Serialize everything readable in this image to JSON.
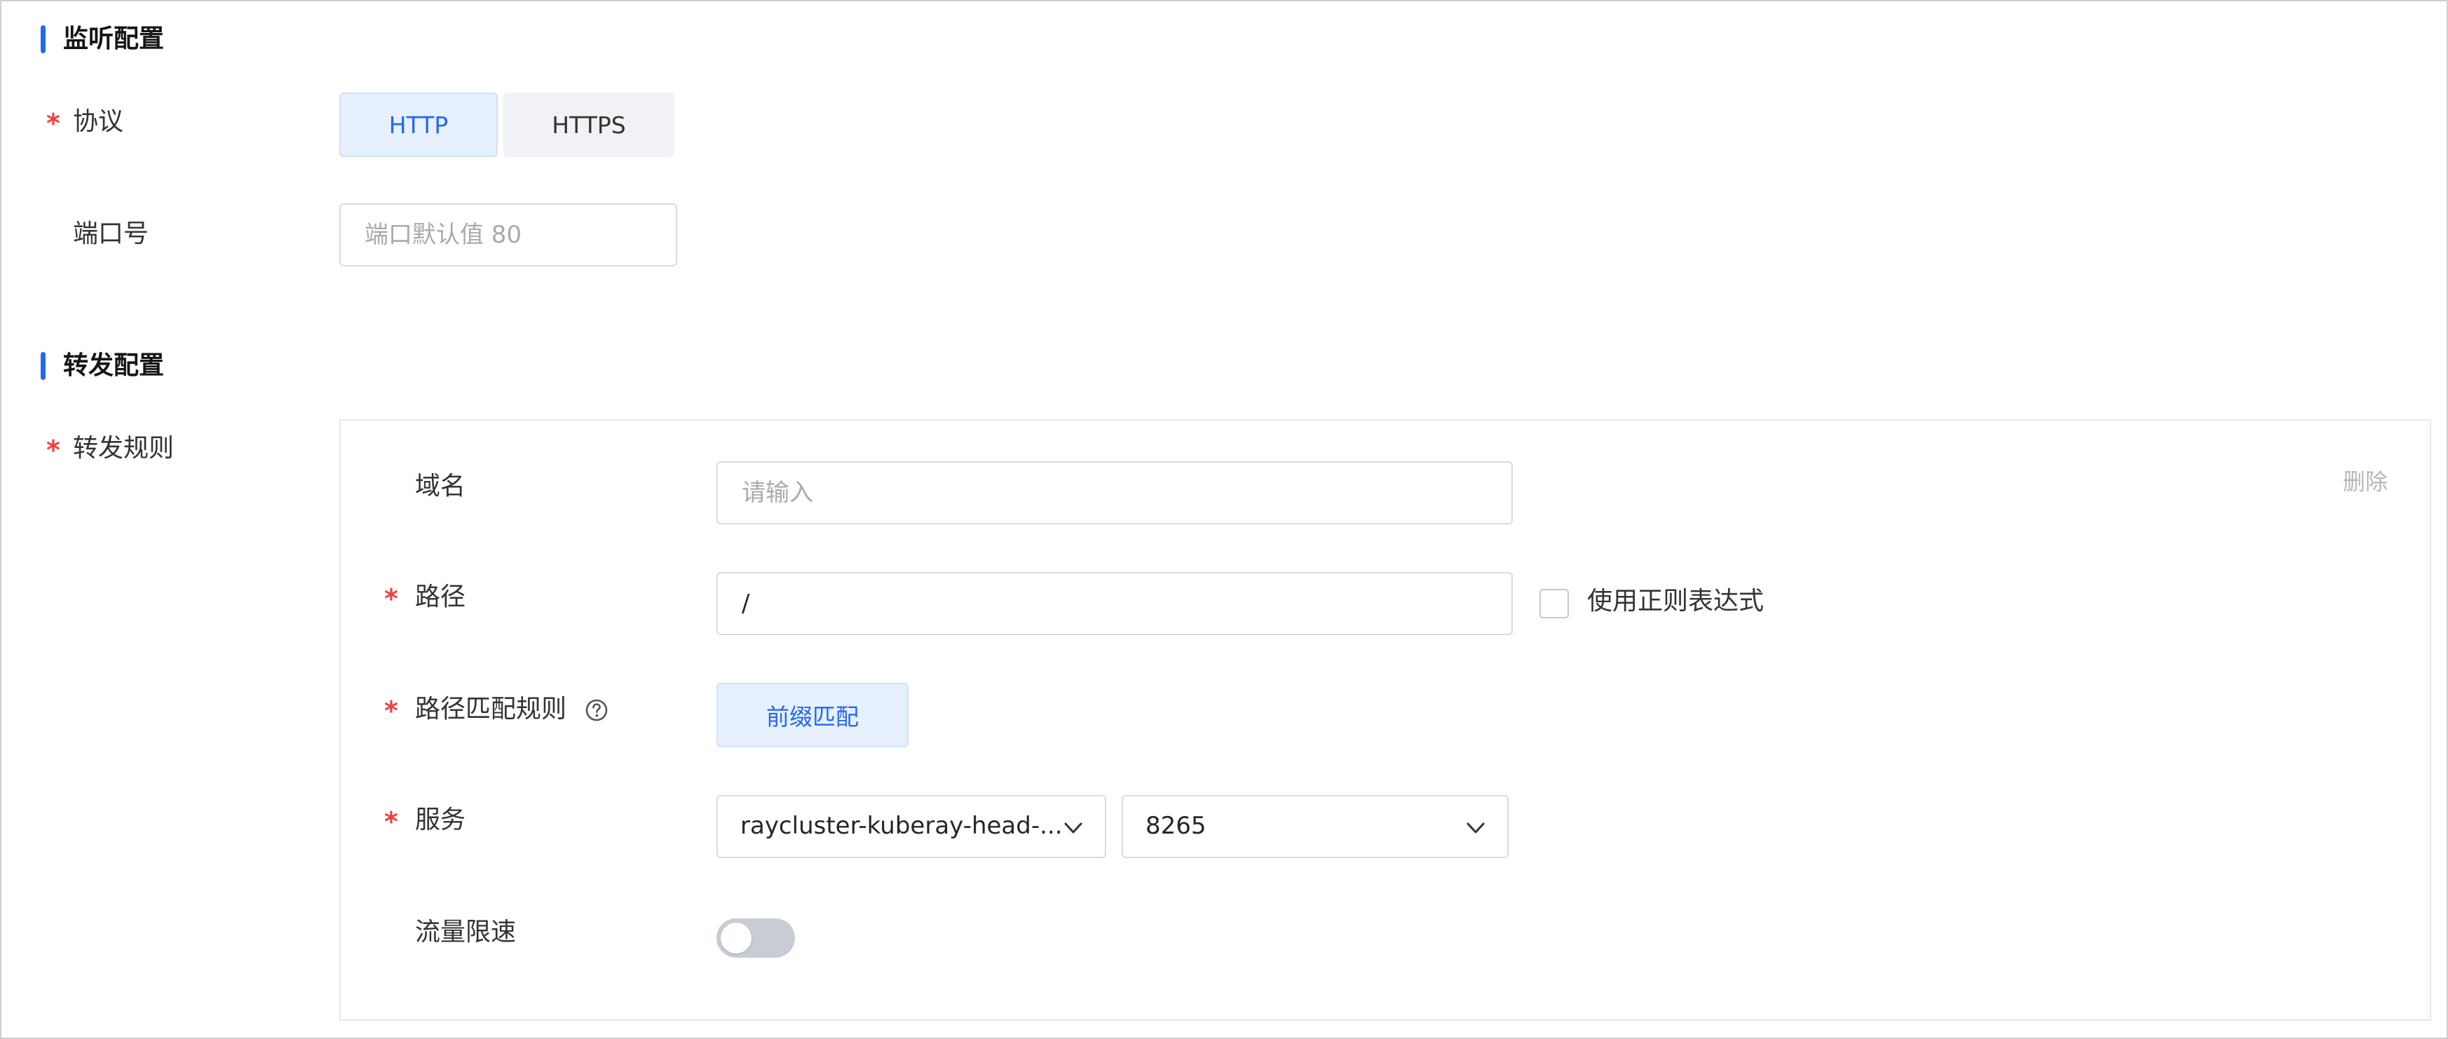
{
  "listen_section": {
    "title": "监听配置",
    "protocol": {
      "label": "协议",
      "options": [
        "HTTP",
        "HTTPS"
      ],
      "selected": "HTTP"
    },
    "port": {
      "label": "端口号",
      "placeholder": "端口默认值 80",
      "value": ""
    }
  },
  "forward_section": {
    "title": "转发配置",
    "rule_label": "转发规则",
    "delete_label": "删除",
    "domain": {
      "label": "域名",
      "placeholder": "请输入",
      "value": ""
    },
    "path": {
      "label": "路径",
      "value": "/",
      "regex_label": "使用正则表达式",
      "regex_checked": false
    },
    "match_rule": {
      "label": "路径匹配规则",
      "help_icon": "question-circle-icon",
      "option": "前缀匹配"
    },
    "service": {
      "label": "服务",
      "name": "raycluster-kuberay-head-...",
      "port": "8265"
    },
    "rate_limit": {
      "label": "流量限速",
      "enabled": false
    }
  },
  "required_mark": "*",
  "colors": {
    "accent": "#2468f2",
    "required": "#f33e3e",
    "active_bg": "#e6f0ff",
    "toggle_off": "#c8ccd5"
  }
}
